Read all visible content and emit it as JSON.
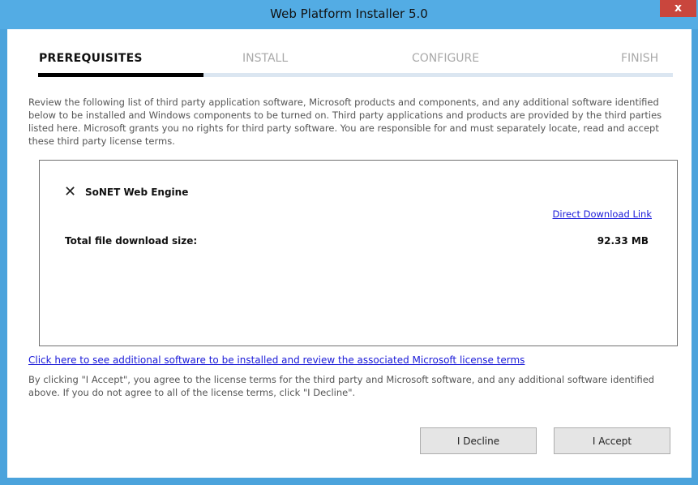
{
  "window": {
    "title": "Web Platform Installer 5.0",
    "close_label": "x"
  },
  "steps": [
    {
      "label": "PREREQUISITES",
      "active": true
    },
    {
      "label": "INSTALL",
      "active": false
    },
    {
      "label": "CONFIGURE",
      "active": false
    },
    {
      "label": "FINISH",
      "active": false
    }
  ],
  "wizard_progress_fraction": 0.26,
  "intro_text": "Review the following list of third party application software, Microsoft products and components, and any additional software identified below to be installed and Windows components to be turned on.  Third party applications and products are provided by the third parties listed here.  Microsoft grants you no rights for third party software.  You are responsible for and must separately locate, read and accept these third party license terms.",
  "package": {
    "remove_glyph": "✕",
    "name": "SoNET Web Engine",
    "direct_link": "Direct Download Link"
  },
  "total": {
    "label": "Total file download size:",
    "value": "92.33 MB"
  },
  "more_link": "Click here to see additional software to be installed and review the associated Microsoft license terms",
  "agreement_text": "By clicking \"I Accept\", you agree to the license terms for the third party and Microsoft software, and any additional software identified above.  If you do not agree to all of the license terms, click \"I Decline\".",
  "buttons": {
    "decline": "I Decline",
    "accept": "I Accept"
  }
}
